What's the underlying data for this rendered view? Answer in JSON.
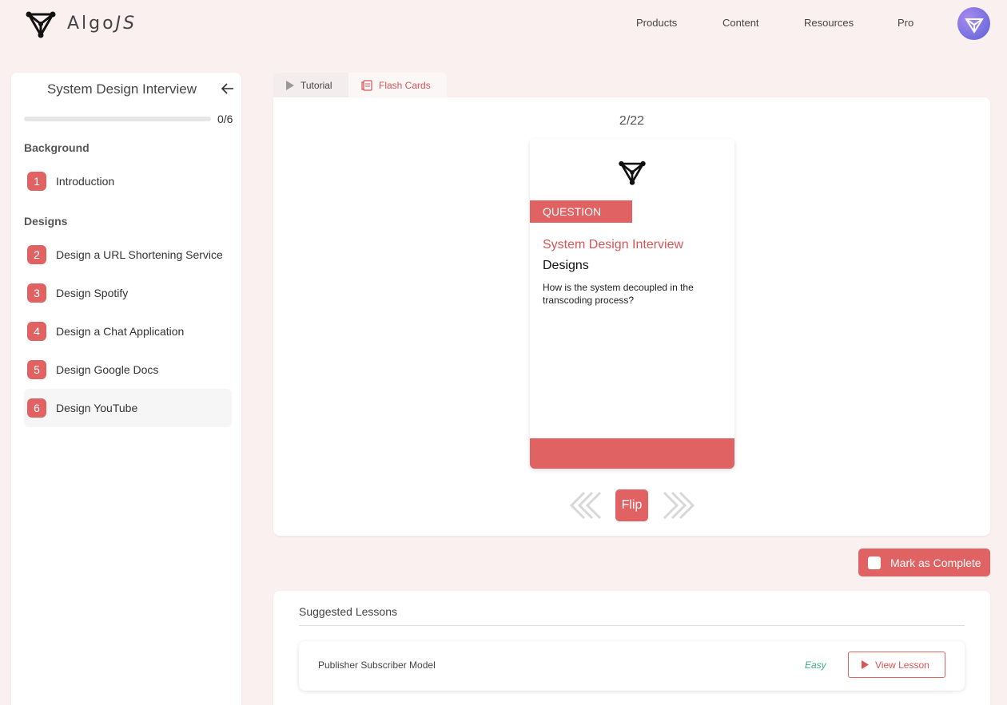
{
  "header": {
    "logo_text_a": "Algo",
    "logo_text_b": "JS",
    "nav": [
      "Products",
      "Content",
      "Resources",
      "Pro"
    ]
  },
  "sidebar": {
    "title": "System Design Interview",
    "progress_text": "0/6",
    "progress_fraction": 0,
    "sections": [
      {
        "title": "Background",
        "items": [
          {
            "num": "1",
            "label": "Introduction"
          }
        ]
      },
      {
        "title": "Designs",
        "items": [
          {
            "num": "2",
            "label": "Design a URL Shortening Service"
          },
          {
            "num": "3",
            "label": "Design Spotify"
          },
          {
            "num": "4",
            "label": "Design a Chat Application"
          },
          {
            "num": "5",
            "label": "Design Google Docs"
          },
          {
            "num": "6",
            "label": "Design YouTube",
            "active": true
          }
        ]
      }
    ]
  },
  "tabs": {
    "tutorial": "Tutorial",
    "flash_cards": "Flash Cards"
  },
  "flashcard": {
    "counter": "2/22",
    "tag": "QUESTION",
    "course": "System Design Interview",
    "section": "Designs",
    "question": "How is the system decoupled in the transcoding process?",
    "flip_label": "Flip"
  },
  "actions": {
    "mark_complete": "Mark as Complete"
  },
  "suggested": {
    "title": "Suggested Lessons",
    "lessons": [
      {
        "name": "Publisher Subscriber Model",
        "difficulty": "Easy",
        "button": "View Lesson"
      }
    ]
  },
  "colors": {
    "accent": "#e06262",
    "background": "#fbf0f0",
    "easy": "#3bb07a"
  }
}
